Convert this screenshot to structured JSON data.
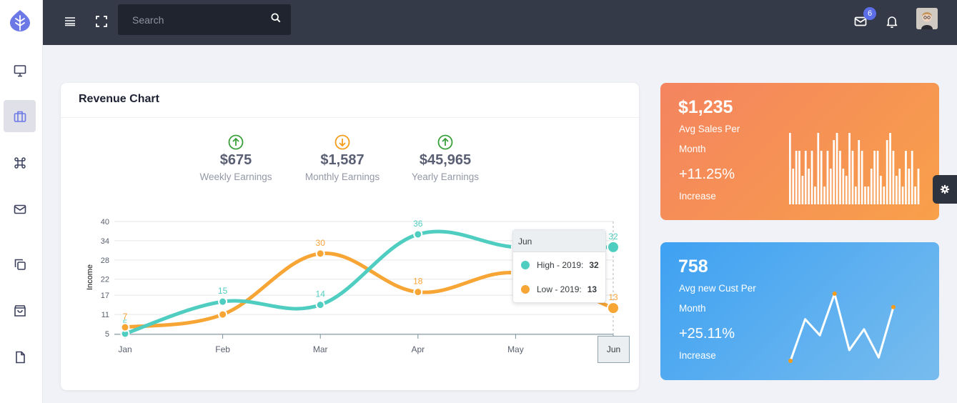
{
  "sidebar": {
    "icons": [
      "monitor-icon",
      "briefcase-icon",
      "command-icon",
      "mail-icon",
      "copy-icon",
      "shopping-bag-icon",
      "file-icon"
    ],
    "active_index": 1
  },
  "topbar": {
    "search_placeholder": "Search",
    "mail_badge": "6"
  },
  "revenue_card": {
    "title": "Revenue Chart",
    "stats": [
      {
        "value": "$675",
        "label": "Weekly Earnings",
        "trend": "up",
        "color": "#3aa03a"
      },
      {
        "value": "$1,587",
        "label": "Monthly Earnings",
        "trend": "down",
        "color": "#f59c1a"
      },
      {
        "value": "$45,965",
        "label": "Yearly Earnings",
        "trend": "up",
        "color": "#3aa03a"
      }
    ],
    "tooltip": {
      "header": "Jun",
      "rows": [
        {
          "label": "High - 2019:",
          "value": "32",
          "color": "#4fcdc0"
        },
        {
          "label": "Low - 2019:",
          "value": "13",
          "color": "#f7a535"
        }
      ]
    },
    "xaxis_tooltip": "Jun"
  },
  "chart_data": {
    "type": "line",
    "categories": [
      "Jan",
      "Feb",
      "Mar",
      "Apr",
      "May",
      "Jun"
    ],
    "series": [
      {
        "name": "High - 2019",
        "values": [
          5,
          15,
          14,
          36,
          32,
          32
        ],
        "color": "#4fcdc0"
      },
      {
        "name": "Low - 2019",
        "values": [
          7,
          11,
          30,
          18,
          24,
          13
        ],
        "color": "#f7a535"
      }
    ],
    "ylabel": "Income",
    "yticks": [
      5,
      11,
      17,
      22,
      28,
      34,
      40
    ],
    "ylim": [
      5,
      40
    ],
    "grid": true,
    "data_labels": {
      "High - 2019": [
        "5",
        "15",
        "14",
        "36",
        "",
        "32"
      ],
      "Low - 2019": [
        "7",
        "",
        "30",
        "18",
        "",
        "13"
      ]
    }
  },
  "sales_card": {
    "value": "$1,235",
    "label_line1": "Avg Sales Per",
    "label_line2": "Month",
    "percent": "+11.25%",
    "percent_label": "Increase",
    "sparkline": [
      100,
      50,
      75,
      75,
      40,
      75,
      50,
      75,
      25,
      100,
      75,
      25,
      75,
      50,
      90,
      100,
      75,
      50,
      40,
      100,
      75,
      25,
      90,
      75,
      25,
      25,
      50,
      75,
      75,
      40,
      25,
      90,
      100,
      75,
      40,
      50,
      25,
      75,
      50,
      75,
      25,
      50
    ]
  },
  "customers_card": {
    "value": "758",
    "label_line1": "Avg new Cust Per",
    "label_line2": "Month",
    "percent": "+25.11%",
    "percent_label": "Increase",
    "sparkline": [
      0,
      62,
      38,
      100,
      16,
      47,
      5,
      80
    ]
  }
}
